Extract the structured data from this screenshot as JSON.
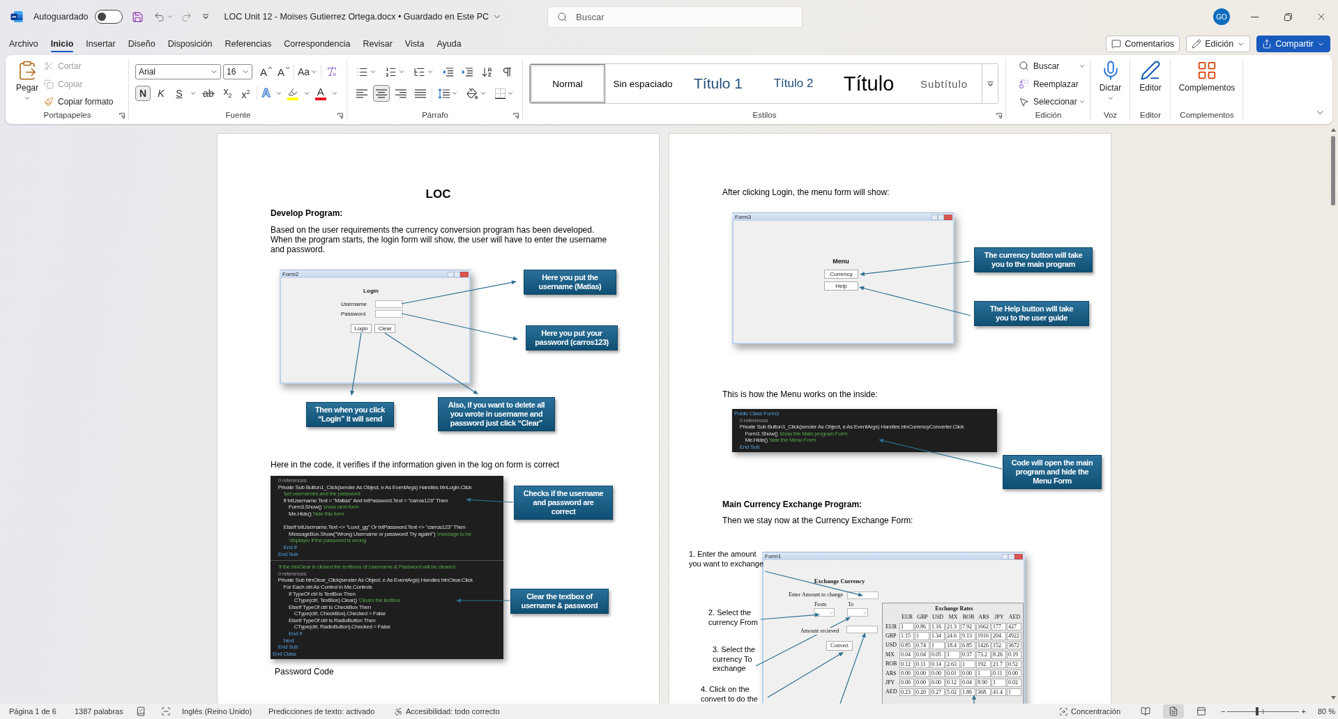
{
  "title_bar": {
    "autosave": {
      "label": "Autoguardado",
      "on": false
    },
    "document_title": "LOC Unit 12 - Moises Gutierrez Ortega.docx • Guardado en Este PC",
    "search": {
      "placeholder": "Buscar"
    },
    "account": "GO"
  },
  "menu_tabs": [
    {
      "label": "Archivo",
      "selected": false
    },
    {
      "label": "Inicio",
      "selected": true
    },
    {
      "label": "Insertar",
      "selected": false
    },
    {
      "label": "Diseño",
      "selected": false
    },
    {
      "label": "Disposición",
      "selected": false
    },
    {
      "label": "Referencias",
      "selected": false
    },
    {
      "label": "Correspondencia",
      "selected": false
    },
    {
      "label": "Revisar",
      "selected": false
    },
    {
      "label": "Vista",
      "selected": false
    },
    {
      "label": "Ayuda",
      "selected": false
    }
  ],
  "header_buttons": [
    {
      "kind": "comments",
      "label": "Comentarios"
    },
    {
      "kind": "editing",
      "label": "Edición"
    },
    {
      "kind": "share",
      "label": "Compartir"
    }
  ],
  "ribbon": {
    "clipboard": {
      "name": "Portapapeles",
      "paste": "Pegar",
      "actions": [
        {
          "kind": "cut",
          "label": "Cortar",
          "disabled": true
        },
        {
          "kind": "copy",
          "label": "Copiar",
          "disabled": true
        },
        {
          "kind": "format_painter",
          "label": "Copiar formato",
          "disabled": false
        }
      ]
    },
    "font": {
      "name": "Fuente",
      "family": "Arial",
      "size": "16",
      "size_buttons": [
        {
          "kind": "grow",
          "label": "A"
        },
        {
          "kind": "shrink",
          "label": "A"
        }
      ],
      "change_case": "Aa",
      "format_buttons": [
        {
          "kind": "bold",
          "label": "N",
          "selected": true
        },
        {
          "kind": "italic",
          "label": "K",
          "selected": false
        },
        {
          "kind": "underline",
          "label": "S",
          "selected": false
        },
        {
          "kind": "strike",
          "label": "ab",
          "selected": false
        },
        {
          "kind": "subscript",
          "label": "x$_{2}$",
          "selected": false
        },
        {
          "kind": "superscript",
          "label": "x$^{2}$",
          "selected": false
        }
      ],
      "color_buttons": [
        {
          "kind": "effects",
          "label": "A"
        },
        {
          "kind": "highlight",
          "color": "#ffff00"
        },
        {
          "kind": "font_color",
          "label": "A",
          "color": "#e81123"
        }
      ]
    },
    "paragraph": {
      "name": "Párrafo",
      "list_buttons": [
        {
          "kind": "bullets",
          "dropdown": true
        },
        {
          "kind": "numbering",
          "dropdown": true
        },
        {
          "kind": "multilevel",
          "dropdown": true
        },
        {
          "kind": "outdent",
          "dropdown": false
        },
        {
          "kind": "indent",
          "dropdown": false
        },
        {
          "kind": "sort",
          "dropdown": false
        },
        {
          "kind": "marks",
          "dropdown": false
        }
      ],
      "align_buttons": [
        {
          "kind": "left",
          "selected": false
        },
        {
          "kind": "center",
          "selected": true
        },
        {
          "kind": "right",
          "selected": false
        },
        {
          "kind": "justify",
          "selected": false
        }
      ],
      "spacing_buttons": [
        {
          "kind": "line_spacing",
          "dropdown": true
        },
        {
          "kind": "shading",
          "dropdown": true
        },
        {
          "kind": "borders",
          "dropdown": true
        }
      ]
    },
    "styles": {
      "name": "Estilos",
      "items": [
        {
          "kind": "normal",
          "label": "Normal",
          "selected": true
        },
        {
          "kind": "no_spacing",
          "label": "Sin espaciado",
          "selected": false
        },
        {
          "kind": "heading1",
          "label": "Título 1",
          "selected": false
        },
        {
          "kind": "heading2",
          "label": "Título 2",
          "selected": false
        },
        {
          "kind": "title",
          "label": "Título",
          "selected": false
        },
        {
          "kind": "subtitle",
          "label": "Subtítulo",
          "selected": false
        }
      ]
    },
    "editing": {
      "name": "Edición",
      "actions": [
        {
          "kind": "find",
          "label": "Buscar",
          "dropdown": true
        },
        {
          "kind": "replace",
          "label": "Reemplazar",
          "dropdown": false
        },
        {
          "kind": "select",
          "label": "Seleccionar",
          "dropdown": true
        }
      ]
    },
    "big_groups": [
      {
        "kind": "dictate",
        "name": "Voz",
        "label": "Dictar",
        "dropdown": true
      },
      {
        "kind": "editor",
        "name": "Editor",
        "label": "Editor",
        "dropdown": false
      },
      {
        "kind": "addins",
        "name": "Complementos",
        "label": "Complementos",
        "dropdown": false
      }
    ]
  },
  "document": {
    "pages": [
      {
        "blocks": [
          {
            "kind": "title",
            "text": "LOC"
          },
          {
            "kind": "heading",
            "text": "Develop Program:"
          },
          {
            "kind": "paragraph",
            "text": "Based on the user requirements the currency conversion program has been developed. When the program starts, the login form will show, the user will have to enter the username and password."
          },
          {
            "kind": "login_form",
            "window": {
              "title": "Form2",
              "heading": "Login",
              "fields": [
                "Username",
                "Password"
              ],
              "buttons": [
                "Login",
                "Clear"
              ]
            },
            "callouts": [
              "Here you put the\nusername (Matias)",
              "Here you put your\npassword (carros123)",
              "Then when you click\n“Login” it will send",
              "Also, if you want to delete all\nyou wrote in username and\npassword just click “Clear”"
            ]
          },
          {
            "kind": "paragraph",
            "text": "Here in the code, it verifies if the information given in the log on form is correct"
          },
          {
            "kind": "code",
            "sections": [
              [
                {
                  "kind": "codelens",
                  "text": "    0 references"
                },
                {
                  "kind": "statement",
                  "text": "    Private Sub Button1_Click(sender As Object, e As EventArgs) Handles btnLogin.Click"
                },
                {
                  "kind": "comment",
                  "text": "        'set usernames and the password"
                },
                {
                  "kind": "statement",
                  "text": "        If txtUsername.Text = \"Matias\" And txtPassword.Text = \"carros123\" Then"
                },
                {
                  "kind": "statement",
                  "text": "            Form3.Show()",
                  "comment": " 'show next form"
                },
                {
                  "kind": "statement",
                  "text": "            Me.Hide()",
                  "comment": " 'hide this form"
                },
                {
                  "kind": "blank"
                },
                {
                  "kind": "statement",
                  "text": "        ElseIf txtUsername.Text <> \"Luxd_gg\" Or txtPassword.Text <> \"carros123\" Then"
                },
                {
                  "kind": "statement",
                  "text": "            MessageBox.Show(\"Wrong Username or password! Try again!\")",
                  "comment": " 'message to be"
                },
                {
                  "kind": "comment",
                  "text": "            'displayer if the password is wrong"
                },
                {
                  "kind": "keyword",
                  "text": "        End If"
                },
                {
                  "kind": "keyword",
                  "text": "    End Sub"
                }
              ],
              [
                {
                  "kind": "comment",
                  "text": "    'If the btnClear is clicked the textboxs of Username & Password will be cleared"
                },
                {
                  "kind": "codelens",
                  "text": "    0 references"
                },
                {
                  "kind": "statement",
                  "text": "    Private Sub btnClear_Click(sender As Object, e As EventArgs) Handles btnClear.Click"
                },
                {
                  "kind": "statement",
                  "text": "        For Each ctrl As Control In Me.Controls"
                },
                {
                  "kind": "statement",
                  "text": "            If TypeOf ctrl Is TextBox Then"
                },
                {
                  "kind": "statement",
                  "text": "                CType(ctrl, TextBox).Clear()",
                  "comment": " 'Clears the textbox"
                },
                {
                  "kind": "statement",
                  "text": "            ElseIf TypeOf ctrl Is CheckBox Then"
                },
                {
                  "kind": "statement",
                  "text": "                CType(ctrl, CheckBox).Checked = False"
                },
                {
                  "kind": "statement",
                  "text": "            ElseIf TypeOf ctrl Is RadioButton Then"
                },
                {
                  "kind": "statement",
                  "text": "                CType(ctrl, RadioButton).Checked = False"
                },
                {
                  "kind": "keyword",
                  "text": "            End If"
                },
                {
                  "kind": "keyword",
                  "text": "        Next"
                },
                {
                  "kind": "keyword",
                  "text": "    End Sub"
                },
                {
                  "kind": "keyword",
                  "text": "End Class"
                }
              ]
            ],
            "callouts": [
              "Checks if the username\nand password are\ncorrect",
              "Clear the textbox of\nusername & password"
            ]
          },
          {
            "kind": "caption",
            "text": "Password Code"
          }
        ]
      },
      {
        "blocks": [
          {
            "kind": "paragraph",
            "text": "After clicking Login, the menu form will show:"
          },
          {
            "kind": "menu_form",
            "window": {
              "title": "Form3",
              "heading": "Menu",
              "buttons": [
                "Currency",
                "Help"
              ]
            },
            "callouts": [
              "The currency button will take\nyou to the main program",
              "The Help button will take\nyou to the user guide"
            ]
          },
          {
            "kind": "paragraph",
            "text": "This is how the Menu works on the inside:"
          },
          {
            "kind": "code",
            "sections": [
              [
                {
                  "kind": "keyword",
                  "text": "Public Class Form3"
                },
                {
                  "kind": "codelens",
                  "text": "    0 references"
                },
                {
                  "kind": "statement",
                  "text": "    Private Sub Button1_Click(sender As Object, e As EventArgs) Handles btnCurrencyConverter.Click"
                },
                {
                  "kind": "statement",
                  "text": "        Form1.Show()",
                  "comment": " 'show the Main program Form"
                },
                {
                  "kind": "statement",
                  "text": "        Me.Hide()",
                  "comment": " 'hide the Menu Form"
                },
                {
                  "kind": "keyword",
                  "text": "    End Sub"
                }
              ]
            ],
            "callouts": [
              "Code will open the main\nprogram and hide the\nMenu Form"
            ]
          },
          {
            "kind": "heading",
            "text": "Main Currency Exchange Program:"
          },
          {
            "kind": "paragraph",
            "text": "Then we stay now at the Currency Exchange Form:"
          },
          {
            "kind": "exchange_form",
            "steps": [
              "1. Enter the amount\nyou want to exchange",
              "2. Select the\ncurrency From",
              "3. Select the\ncurrency To\nexchange",
              "4. Click on the\nconvert to do the"
            ],
            "window": {
              "title": "Form1",
              "heading": "Exchange Currency",
              "amount_label": "Enter Amount to change",
              "from_label": "From",
              "to_label": "To",
              "received_label": "Amount recieved",
              "convert": "Convert",
              "rates": {
                "title": "Exchange Rates",
                "columns": [
                  "EUR",
                  "GBP",
                  "USD",
                  "MX",
                  "BOB",
                  "ARS",
                  "JPY",
                  "AED"
                ],
                "rows": [
                  {
                    "currency": "EUR",
                    "values": [
                      "1",
                      "0.86",
                      "1.16",
                      "21.3",
                      "7.92",
                      "1662",
                      "177.",
                      "427"
                    ]
                  },
                  {
                    "currency": "GBP",
                    "values": [
                      "1.15",
                      "1",
                      "1.34",
                      "24.6",
                      "9.13",
                      "1916",
                      "204.",
                      "4922"
                    ]
                  },
                  {
                    "currency": "USD",
                    "values": [
                      "0.85",
                      "0.74",
                      "1",
                      "18.4",
                      "6.85",
                      "1426",
                      "152.",
                      "3672"
                    ]
                  },
                  {
                    "currency": "MX",
                    "values": [
                      "0.04",
                      "0.04",
                      "0.05",
                      "1",
                      "0.37",
                      "73.2",
                      "8.26",
                      "0.19"
                    ]
                  },
                  {
                    "currency": "BOB",
                    "values": [
                      "0.12",
                      "0.11",
                      "0.14",
                      "2.63",
                      "1",
                      "192.",
                      "21.7",
                      "0.52"
                    ]
                  },
                  {
                    "currency": "ARS",
                    "values": [
                      "0.00",
                      "0.00",
                      "0.00",
                      "0.01",
                      "0.00",
                      "1",
                      "0.11",
                      "0.00"
                    ]
                  },
                  {
                    "currency": "JPY",
                    "values": [
                      "0.00",
                      "0.00",
                      "0.00",
                      "0.12",
                      "0.04",
                      "8.90",
                      "1",
                      "0.02"
                    ]
                  },
                  {
                    "currency": "AED",
                    "values": [
                      "0.23",
                      "0.20",
                      "0.27",
                      "5.02",
                      "1.86",
                      "368.",
                      "41.4",
                      "1"
                    ]
                  }
                ]
              }
            }
          }
        ]
      }
    ]
  },
  "status_bar": {
    "page": "Página 1 de 6",
    "words": "1387 palabras",
    "language": "Inglés (Reino Unido)",
    "predictions": "Predicciones de texto: activado",
    "accessibility": "Accesibilidad: todo correcto",
    "focus": "Concentración",
    "views": [
      {
        "kind": "read",
        "selected": false
      },
      {
        "kind": "print",
        "selected": true
      },
      {
        "kind": "web",
        "selected": false
      }
    ],
    "zoom_out": "−",
    "zoom_in": "+",
    "zoom": {
      "level": 0.41,
      "reading": "80 %"
    }
  }
}
